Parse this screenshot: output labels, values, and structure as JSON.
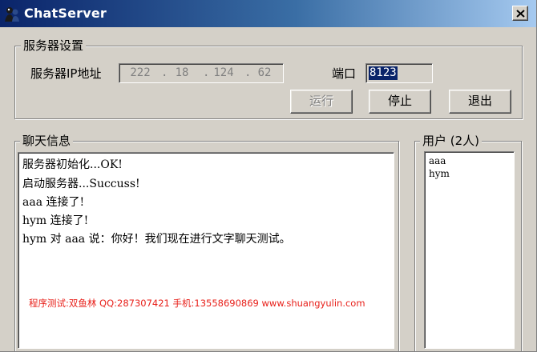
{
  "window": {
    "title": "ChatServer"
  },
  "server_settings": {
    "group_title": "服务器设置",
    "ip_label": "服务器IP地址",
    "ip_parts": [
      "222",
      "18",
      "124",
      "62"
    ],
    "ip_dot": ".",
    "port_label": "端口",
    "port_value": "8123"
  },
  "buttons": {
    "run_label": "运行",
    "stop_label": "停止",
    "exit_label": "退出"
  },
  "chat": {
    "group_title": "聊天信息",
    "lines": [
      "服务器初始化...OK!",
      "启动服务器...Succuss!",
      "aaa 连接了!",
      "hym 连接了!",
      "hym 对 aaa 说：你好！我们现在进行文字聊天测试。"
    ]
  },
  "users": {
    "group_title": "用户 (2人)",
    "items": [
      "aaa",
      "hym"
    ]
  },
  "watermark": "程序测试:双鱼林 QQ:287307421 手机:13558690869 www.shuangyulin.com",
  "colors": {
    "titlebar_start": "#0a246a",
    "titlebar_end": "#a6caf0",
    "face": "#d4d0c8",
    "selection": "#0a246a",
    "watermark": "#e8201a"
  }
}
